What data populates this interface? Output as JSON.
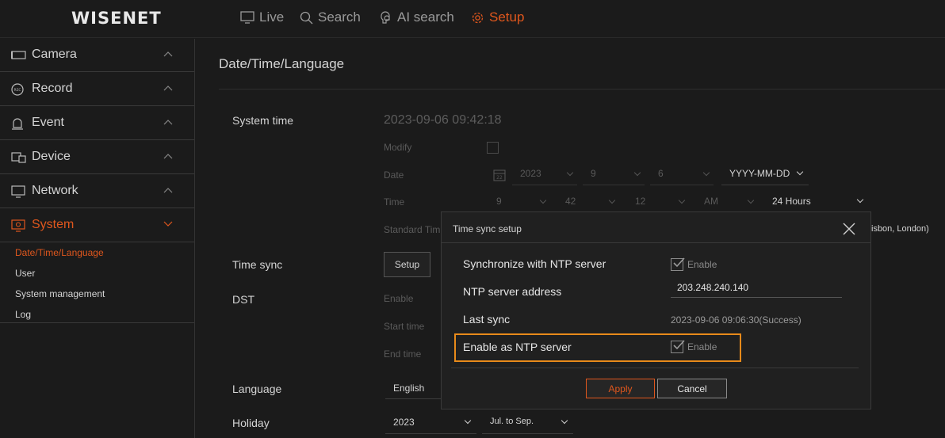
{
  "brand": {
    "logo": "WISENET"
  },
  "topnav": [
    {
      "label": "Live",
      "icon": "monitor-icon",
      "active": false
    },
    {
      "label": "Search",
      "icon": "search-icon",
      "active": false
    },
    {
      "label": "AI search",
      "icon": "ai-search-icon",
      "active": false
    },
    {
      "label": "Setup",
      "icon": "gear-icon",
      "active": true
    }
  ],
  "colors": {
    "accent": "#e0571d",
    "highlight": "#e88a1a",
    "background": "#1b1b1b"
  },
  "sidebar": {
    "items": [
      {
        "label": "Camera",
        "icon": "camera-icon"
      },
      {
        "label": "Record",
        "icon": "rec-icon"
      },
      {
        "label": "Event",
        "icon": "bell-icon"
      },
      {
        "label": "Device",
        "icon": "device-icon"
      },
      {
        "label": "Network",
        "icon": "network-monitor-icon"
      },
      {
        "label": "System",
        "icon": "system-icon",
        "active": true
      }
    ],
    "subitems": [
      {
        "label": "Date/Time/Language",
        "active": true
      },
      {
        "label": "User"
      },
      {
        "label": "System management"
      },
      {
        "label": "Log"
      }
    ]
  },
  "page": {
    "title": "Date/Time/Language",
    "system_time_label": "System time",
    "system_time_value": "2023-09-06 09:42:18",
    "modify_label": "Modify",
    "date_label": "Date",
    "date_year": "2023",
    "date_month": "9",
    "date_day": "6",
    "date_format": "YYYY-MM-DD",
    "time_label": "Time",
    "time_hour": "9",
    "time_min": "42",
    "time_sec": "12",
    "time_ampm": "AM",
    "time_format": "24 Hours",
    "standard_time_label": "Standard Tim",
    "standard_time_value": "isbon, London)",
    "time_sync_label": "Time sync",
    "setup_button": "Setup",
    "dst_label": "DST",
    "dst_enable": "Enable",
    "dst_start": "Start time",
    "dst_end": "End time",
    "language_label": "Language",
    "language_value": "English",
    "holiday_label": "Holiday",
    "holiday_year": "2023",
    "holiday_range": "Jul. to Sep."
  },
  "modal": {
    "title": "Time sync setup",
    "sync_label": "Synchronize with NTP server",
    "sync_enable": "Enable",
    "sync_checked": true,
    "ntp_addr_label": "NTP server address",
    "ntp_addr_value": "203.248.240.140",
    "last_sync_label": "Last sync",
    "last_sync_value": "2023-09-06 09:06:30(Success)",
    "enable_server_label": "Enable as NTP server",
    "enable_server_text": "Enable",
    "enable_server_checked": true,
    "apply_button": "Apply",
    "cancel_button": "Cancel"
  }
}
